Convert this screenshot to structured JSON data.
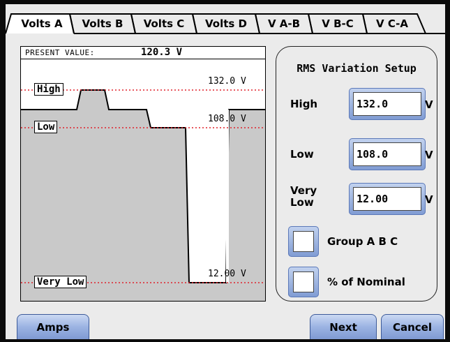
{
  "tabs": [
    {
      "label": "Volts A",
      "active": true
    },
    {
      "label": "Volts B",
      "active": false
    },
    {
      "label": "Volts C",
      "active": false
    },
    {
      "label": "Volts D",
      "active": false
    },
    {
      "label": "V A-B",
      "active": false
    },
    {
      "label": "V B-C",
      "active": false
    },
    {
      "label": "V C-A",
      "active": false
    }
  ],
  "graph": {
    "present_label": "PRESENT VALUE:",
    "present_value": "120.3 V",
    "threshold_labels": {
      "high": "High",
      "low": "Low",
      "very_low": "Very Low"
    },
    "threshold_values": {
      "high": "132.0 V",
      "low": "108.0 V",
      "very_low": "12.00 V"
    },
    "line_color": "#e0202a",
    "fill_color": "#c9c9c9"
  },
  "setup": {
    "title": "RMS Variation Setup",
    "high_label": "High",
    "high_value": "132.0",
    "low_label": "Low",
    "low_value": "108.0",
    "very_low_label": "Very\nLow",
    "very_low_value": "12.00",
    "unit": "V",
    "group_label": "Group A B C",
    "group_checked": false,
    "nominal_label": "% of Nominal",
    "nominal_checked": false
  },
  "buttons": {
    "amps": "Amps",
    "next": "Next",
    "cancel": "Cancel"
  },
  "colors": {
    "accent": "#8ea7dc",
    "screen_bg": "#ebebeb",
    "bezel": "#0b0b0b"
  }
}
